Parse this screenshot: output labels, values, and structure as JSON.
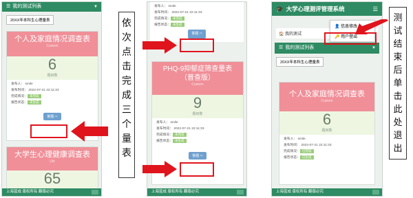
{
  "panel1": {
    "section_title": "我的测试列表",
    "dropdown_value": "20XX年本科生心理量表",
    "card1": {
      "title": "个人及家庭情况调查表",
      "subtitle": "Custom",
      "count": "6",
      "count_label": "题目数",
      "publisher": "发布人：  smile",
      "date": "发布时间：  2022-07-21 22:11:33",
      "done_label": "完成情况：",
      "done_tag": "未完成",
      "status_label": "报告状态：",
      "status_tag": "未生成",
      "answer": "答题 ⇨"
    },
    "card2": {
      "title": "大学生心理健康调查表",
      "subtitle": "Ukr",
      "count": "65"
    },
    "footer": "上海蓝成 版权所有 翻版必究"
  },
  "panel2": {
    "top_publisher": "发布人：  smile",
    "top_date": "发布时间：  2022-07-21 22:11:33",
    "top_done_label": "完成情况：",
    "top_done_tag": "未完成",
    "top_status_label": "报告状态：",
    "top_status_tag": "未生成",
    "top_answer": "答题 ⇨",
    "card": {
      "title": "PHQ-9抑郁症筛查量表（普查版）",
      "subtitle": "Custom",
      "count": "9",
      "count_label": "题目数",
      "publisher": "发布人：  smile",
      "date": "发布时间：  2022-07-21 22:11:33",
      "done_label": "完成情况：",
      "done_tag": "未完成",
      "status_label": "报告状态：",
      "status_tag": "未生成",
      "answer": "答题 ⇨"
    },
    "footer": "上海蓝成 版权所有 翻版必究"
  },
  "panel3": {
    "app_title": "大学心理测评管理系统",
    "menu_items": [
      "信息修改",
      "用户登出"
    ],
    "breadcrumb": "我的测试",
    "section_title": "我的测试列表",
    "dropdown_value": "20XX年本科生心理量表",
    "card": {
      "title": "个人及家庭情况调查表",
      "subtitle": "Custom",
      "count": "6",
      "count_label": "题目数",
      "publisher": "发布人：  smile",
      "date": "发布时间：  2022-07-21 22:11:33",
      "done_label": "完成情况：",
      "done_tag": "已完成",
      "status_label": "报告状态：",
      "status_tag": "已生成"
    },
    "footer": "上海蓝成 版权所有 翻版必究"
  },
  "annotations": {
    "middle_text": "依次点击完成三个量表",
    "right_text": "测试结束后单击此处退出"
  },
  "colors": {
    "brand": "#2e8b63",
    "card_head": "#f08f98",
    "highlight": "#e0141c"
  }
}
